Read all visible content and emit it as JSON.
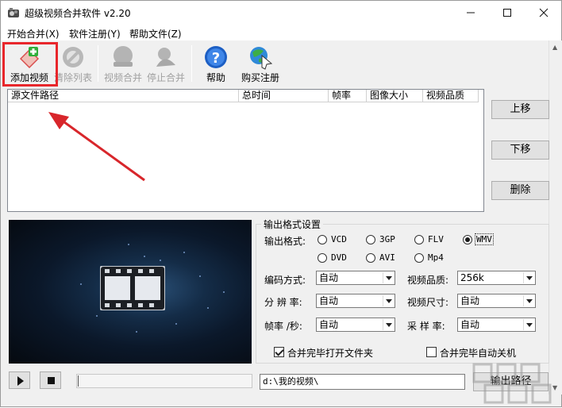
{
  "window": {
    "title": "超级视频合并软件 v2.20",
    "minimize_icon": "minimize-icon",
    "maximize_icon": "maximize-icon",
    "close_icon": "close-icon"
  },
  "menu": [
    "开始合并(X)",
    "软件注册(Y)",
    "帮助文件(Z)"
  ],
  "toolbar": {
    "add": "添加视频",
    "clear": "清除列表",
    "merge": "视频合并",
    "stop": "停止合并",
    "help": "帮助",
    "buy": "购买注册"
  },
  "list_columns": [
    "源文件路径",
    "总时间",
    "帧率",
    "图像大小",
    "视频品质"
  ],
  "side_buttons": {
    "up": "上移",
    "down": "下移",
    "delete": "删除"
  },
  "output": {
    "group_title": "输出格式设置",
    "format_label": "输出格式:",
    "formats": [
      "VCD",
      "3GP",
      "FLV",
      "WMV",
      "DVD",
      "AVI",
      "Mp4"
    ],
    "selected_format": "WMV",
    "encoding_label": "编码方式:",
    "encoding_value": "自动",
    "quality_label": "视频品质:",
    "quality_value": "256k",
    "resolution_label": "分 辨 率:",
    "resolution_value": "自动",
    "size_label": "视频尺寸:",
    "size_value": "自动",
    "fps_label": "帧率 /秒:",
    "fps_value": "自动",
    "sample_label": "采 样 率:",
    "sample_value": "自动",
    "open_folder_label": "合并完毕打开文件夹",
    "open_folder_checked": true,
    "shutdown_label": "合并完毕自动关机",
    "shutdown_checked": false
  },
  "bottom": {
    "path_value": "d:\\我的视频\\",
    "output_path_button": "输出路径"
  },
  "colors": {
    "highlight_box": "#e8262b",
    "annotation_arrow": "#d8262b",
    "window_bg": "#f0f0f0"
  }
}
